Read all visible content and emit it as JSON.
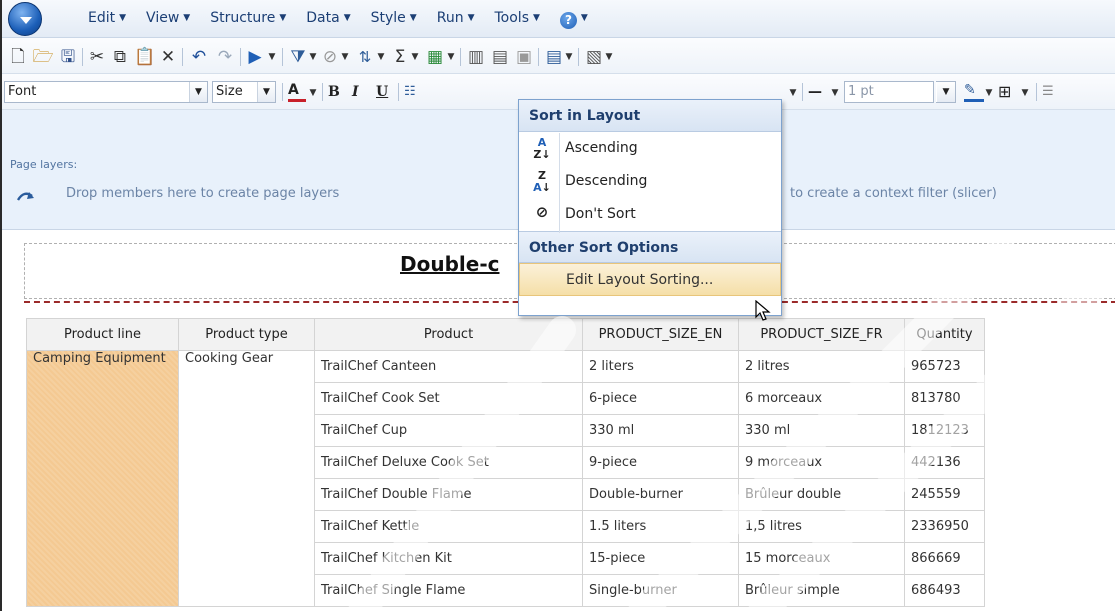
{
  "menubar": {
    "items": [
      "Edit",
      "View",
      "Structure",
      "Data",
      "Style",
      "Run",
      "Tools"
    ],
    "help_icon": "?"
  },
  "toolbar2": {
    "font_combo": "Font",
    "size_combo": "Size",
    "line_weight": "1 pt"
  },
  "layers": {
    "title": "Page layers:",
    "hint": "Drop members here to create page layers",
    "context_hint": "to create a context filter (slicer)"
  },
  "report": {
    "title": "Double-c"
  },
  "table": {
    "headers": [
      "Product line",
      "Product type",
      "Product",
      "PRODUCT_SIZE_EN",
      "PRODUCT_SIZE_FR",
      "Quantity"
    ],
    "product_line": "Camping Equipment",
    "product_type": "Cooking Gear",
    "rows": [
      {
        "product": "TrailChef Canteen",
        "size_en": "2 liters",
        "size_fr": "2 litres",
        "qty": "965723"
      },
      {
        "product": "TrailChef Cook Set",
        "size_en": "6-piece",
        "size_fr": "6 morceaux",
        "qty": "813780"
      },
      {
        "product": "TrailChef Cup",
        "size_en": "330 ml",
        "size_fr": "330 ml",
        "qty": "1812123"
      },
      {
        "product": "TrailChef Deluxe Cook Set",
        "size_en": "9-piece",
        "size_fr": "9 morceaux",
        "qty": "442136"
      },
      {
        "product": "TrailChef Double Flame",
        "size_en": "Double-burner",
        "size_fr": "Brûleur double",
        "qty": "245559"
      },
      {
        "product": "TrailChef Kettle",
        "size_en": "1.5 liters",
        "size_fr": "1,5 litres",
        "qty": "2336950"
      },
      {
        "product": "TrailChef Kitchen Kit",
        "size_en": "15-piece",
        "size_fr": "15 morceaux",
        "qty": "866669"
      },
      {
        "product": "TrailChef Single Flame",
        "size_en": "Single-burner",
        "size_fr": "Brûleur simple",
        "qty": "686493"
      }
    ]
  },
  "sort_menu": {
    "header1": "Sort in Layout",
    "ascending": "Ascending",
    "descending": "Descending",
    "dont_sort": "Don't Sort",
    "header2": "Other Sort Options",
    "edit_sorting": "Edit Layout Sorting..."
  },
  "colors": {
    "accent": "#1c5fb8",
    "product_line_fill": "#f4c992",
    "highlight": "#f5dfa8"
  }
}
